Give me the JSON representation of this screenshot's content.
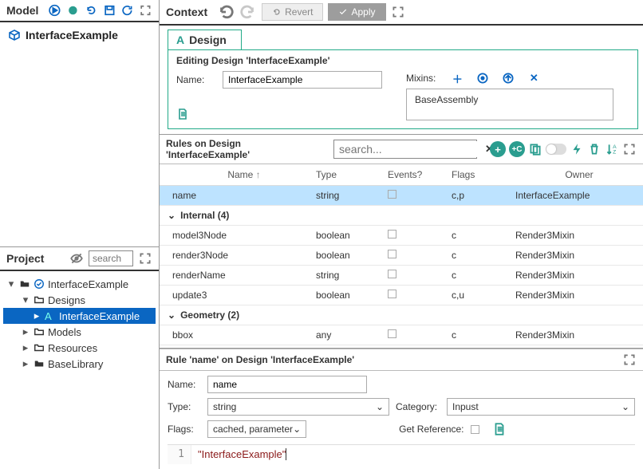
{
  "model": {
    "title": "Model",
    "root": "InterfaceExample"
  },
  "project": {
    "title": "Project",
    "search_placeholder": "search",
    "tree": {
      "root": "InterfaceExample",
      "designs_label": "Designs",
      "design_item": "InterfaceExample",
      "models_label": "Models",
      "resources_label": "Resources",
      "baselib_label": "BaseLibrary"
    }
  },
  "context": {
    "title": "Context",
    "revert": "Revert",
    "apply": "Apply",
    "tab_label": "Design",
    "editing_subtitle": "Editing Design 'InterfaceExample'",
    "name_label": "Name:",
    "name_value": "InterfaceExample",
    "mixins_label": "Mixins:",
    "mixin_value": "BaseAssembly"
  },
  "rules": {
    "title": "Rules on Design 'InterfaceExample'",
    "search_placeholder": "search...",
    "columns": {
      "name": "Name",
      "type": "Type",
      "events": "Events?",
      "flags": "Flags",
      "owner": "Owner"
    },
    "row_selected": {
      "name": "name",
      "type": "string",
      "flags": "c,p",
      "owner": "InterfaceExample"
    },
    "group_internal": "Internal (4)",
    "internal": [
      {
        "name": "model3Node",
        "type": "boolean",
        "flags": "c",
        "owner": "Render3Mixin"
      },
      {
        "name": "render3Node",
        "type": "boolean",
        "flags": "c",
        "owner": "Render3Mixin"
      },
      {
        "name": "renderName",
        "type": "string",
        "flags": "c",
        "owner": "Render3Mixin"
      },
      {
        "name": "update3",
        "type": "boolean",
        "flags": "c,u",
        "owner": "Render3Mixin"
      }
    ],
    "group_geometry": "Geometry (2)",
    "geometry": [
      {
        "name": "bbox",
        "type": "any",
        "flags": "c",
        "owner": "Render3Mixin"
      }
    ]
  },
  "editor": {
    "title": "Rule 'name' on Design 'InterfaceExample'",
    "name_label": "Name:",
    "name_value": "name",
    "type_label": "Type:",
    "type_value": "string",
    "category_label": "Category:",
    "category_value": "Inpust",
    "flags_label": "Flags:",
    "flags_value": "cached, parameter",
    "getref_label": "Get Reference:",
    "line_no": "1",
    "code": "\"InterfaceExample\""
  }
}
